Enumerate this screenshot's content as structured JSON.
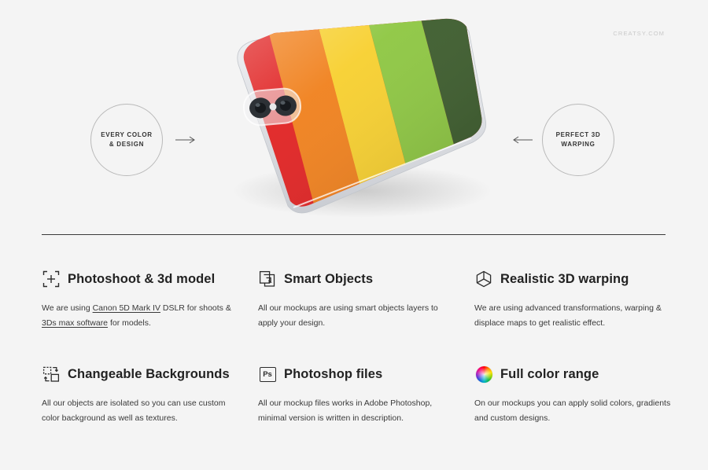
{
  "watermark": "CREATSY.COM",
  "hero": {
    "badge_left": {
      "name": "every-color-design",
      "text": "EVERY COLOR\n& DESIGN",
      "arrow": "arrow-right-icon"
    },
    "badge_right": {
      "name": "perfect-3d-warping",
      "text": "PERFECT 3D\nWARPING",
      "arrow": "arrow-left-icon"
    },
    "mockup": {
      "name": "rainbow-phone-case-mockup",
      "stripe_colors": [
        "#e02020",
        "#f07f1a",
        "#f7cf2c",
        "#8cc63f",
        "#3a5a2a",
        "#5aa9d6",
        "#a12a7e",
        "#4a2338"
      ],
      "body_color": "#e9eaec",
      "camera": "dual-camera-module"
    }
  },
  "features": [
    {
      "icon": "focus-crosshair-icon",
      "title": "Photoshoot & 3d model",
      "body_parts": [
        {
          "text": "We are using ",
          "underline": false
        },
        {
          "text": "Canon 5D Mark IV",
          "underline": true
        },
        {
          "text": " DSLR for shoots & ",
          "underline": false
        },
        {
          "text": "3Ds max software",
          "underline": true
        },
        {
          "text": " for models.",
          "underline": false
        }
      ]
    },
    {
      "icon": "smart-object-icon",
      "title": "Smart Objects",
      "body_parts": [
        {
          "text": "All our mockups are using smart objects layers to apply your design.",
          "underline": false
        }
      ]
    },
    {
      "icon": "cube-3d-icon",
      "title": "Realistic 3D warping",
      "body_parts": [
        {
          "text": "We are using advanced transformations, warping & displace maps to get realistic effect.",
          "underline": false
        }
      ]
    },
    {
      "icon": "swap-backgrounds-icon",
      "title": "Changeable Backgrounds",
      "body_parts": [
        {
          "text": "All our objects are isolated so you can use custom color background as well as textures.",
          "underline": false
        }
      ]
    },
    {
      "icon": "photoshop-ps-icon",
      "title": "Photoshop files",
      "icon_label": "Ps",
      "body_parts": [
        {
          "text": "All our mockup files works in Adobe Photoshop, minimal version is written in description.",
          "underline": false
        }
      ]
    },
    {
      "icon": "color-wheel-icon",
      "title": "Full color range",
      "body_parts": [
        {
          "text": "On our mockups you can apply solid colors, gradients and custom designs.",
          "underline": false
        }
      ]
    }
  ],
  "colors": {
    "background": "#f4f4f4",
    "divider": "#3b3b3b",
    "text": "#2c2c2c",
    "badge_border": "#b9b9b9",
    "watermark": "#c9c9c9"
  }
}
